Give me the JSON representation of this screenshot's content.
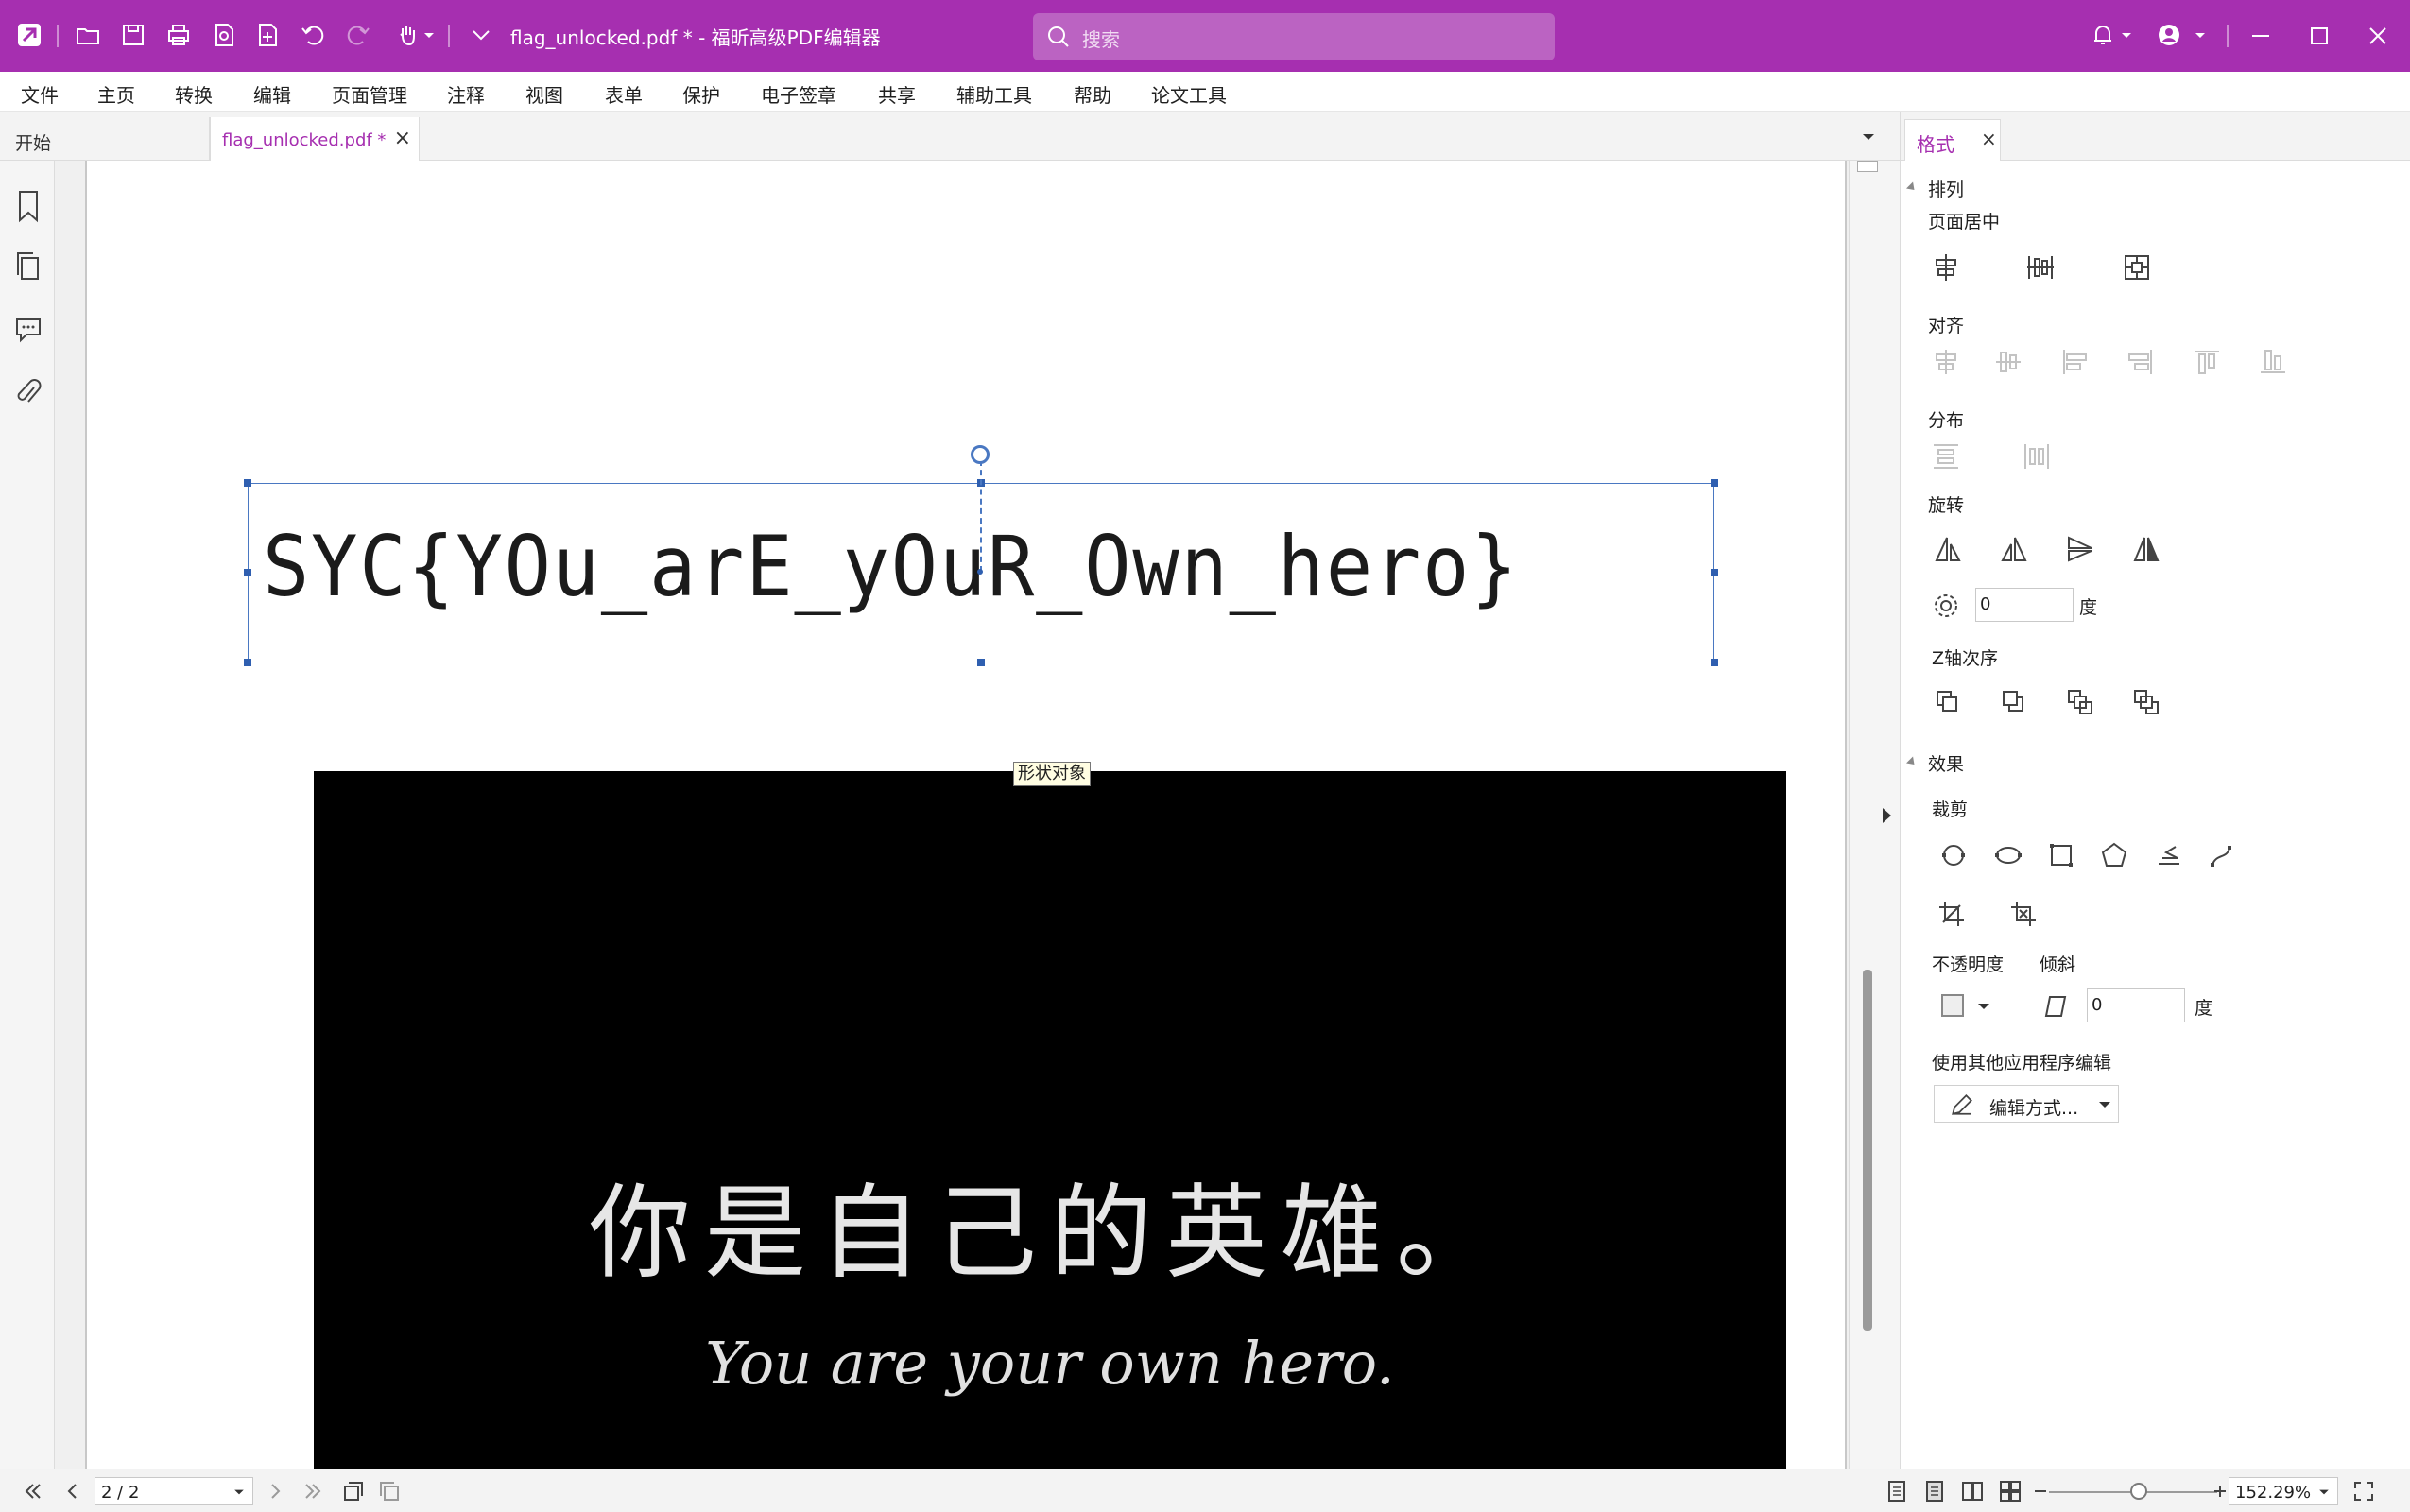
{
  "title_bar": {
    "title": "flag_unlocked.pdf * - 福昕高级PDF编辑器",
    "search_placeholder": "搜索"
  },
  "menu": {
    "items": [
      "文件",
      "主页",
      "转换",
      "编辑",
      "页面管理",
      "注释",
      "视图",
      "表单",
      "保护",
      "电子签章",
      "共享",
      "辅助工具",
      "帮助",
      "论文工具"
    ]
  },
  "tabs": {
    "start": "开始",
    "doc": "flag_unlocked.pdf *",
    "close": "×"
  },
  "document": {
    "flag_text": "SYC{YOu_arE_yOuR_Own_hero}",
    "tooltip": "形状对象",
    "image_cn": "你是自己的英雄。",
    "image_en": "You are your own hero."
  },
  "format_panel": {
    "tab": "格式",
    "close": "×",
    "arrange": "排列",
    "page_center": "页面居中",
    "align": "对齐",
    "distribute": "分布",
    "rotate": "旋转",
    "rotate_value": "0",
    "degree": "度",
    "z_order": "Z轴次序",
    "effects": "效果",
    "crop": "裁剪",
    "opacity": "不透明度",
    "skew": "倾斜",
    "skew_value": "0",
    "skew_degree": "度",
    "edit_with_other": "使用其他应用程序编辑",
    "edit_method": "编辑方式..."
  },
  "status_bar": {
    "page": "2 / 2",
    "zoom": "152.29%"
  },
  "colors": {
    "brand": "#a62fb0",
    "selection": "#4a78c2"
  }
}
